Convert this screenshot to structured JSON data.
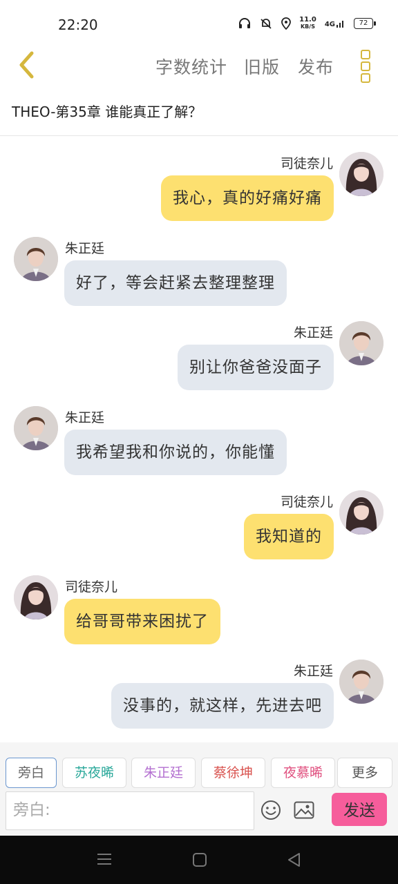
{
  "status_bar": {
    "time": "22:20",
    "net_speed_value": "11.0",
    "net_speed_unit": "KB/S",
    "network": "4G",
    "battery": "72"
  },
  "top_bar": {
    "actions": [
      "字数统计",
      "旧版",
      "发布"
    ],
    "accent_color": "#d5b73d"
  },
  "chapter_title": "THEO-第35章 谁能真正了解？",
  "messages": [
    {
      "side": "right",
      "name": "司徒奈儿",
      "text": "我心，真的好痛好痛",
      "bubble": "yellow"
    },
    {
      "side": "left",
      "name": "朱正廷",
      "text": "好了，等会赶紧去整理整理",
      "bubble": "gray"
    },
    {
      "side": "right",
      "name": "朱正廷",
      "text": "别让你爸爸没面子",
      "bubble": "gray"
    },
    {
      "side": "left",
      "name": "朱正廷",
      "text": "我希望我和你说的，你能懂",
      "bubble": "gray"
    },
    {
      "side": "right",
      "name": "司徒奈儿",
      "text": "我知道的",
      "bubble": "yellow"
    },
    {
      "side": "left",
      "name": "司徒奈儿",
      "text": "给哥哥带来困扰了",
      "bubble": "yellow"
    },
    {
      "side": "right",
      "name": "朱正廷",
      "text": "没事的，就这样，先进去吧",
      "bubble": "gray"
    }
  ],
  "role_tabs": [
    {
      "label": "旁白",
      "color": "#666666",
      "active": true
    },
    {
      "label": "苏夜晞",
      "color": "#2aa89a",
      "active": false
    },
    {
      "label": "朱正廷",
      "color": "#b36fd0",
      "active": false
    },
    {
      "label": "蔡徐坤",
      "color": "#d9534f",
      "active": false
    },
    {
      "label": "夜慕晞",
      "color": "#e0507f",
      "active": false
    },
    {
      "label": "更多",
      "color": "#555555",
      "active": false
    }
  ],
  "input": {
    "placeholder": "旁白:",
    "value": ""
  },
  "send_label": "发送",
  "colors": {
    "bubble_yellow": "#fde070",
    "bubble_gray": "#e3e8ef",
    "send_button": "#f65d9b"
  }
}
